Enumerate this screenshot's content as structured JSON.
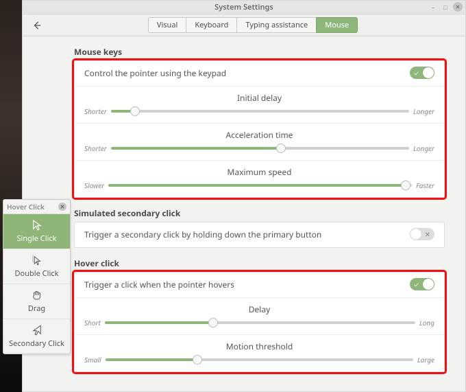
{
  "window": {
    "title": "System Settings"
  },
  "tabs": [
    {
      "label": "Visual",
      "active": false
    },
    {
      "label": "Keyboard",
      "active": false
    },
    {
      "label": "Typing assistance",
      "active": false
    },
    {
      "label": "Mouse",
      "active": true
    }
  ],
  "mouse_keys": {
    "title": "Mouse keys",
    "control_label": "Control the pointer using the keypad",
    "control_on": true,
    "sliders": {
      "initial_delay": {
        "caption": "Initial delay",
        "left": "Shorter",
        "right": "Longer",
        "value_pct": 8
      },
      "acceleration_time": {
        "caption": "Acceleration time",
        "left": "Shorter",
        "right": "Longer",
        "value_pct": 57
      },
      "maximum_speed": {
        "caption": "Maximum speed",
        "left": "Slower",
        "right": "Faster",
        "value_pct": 98
      }
    }
  },
  "sim_secondary": {
    "title": "Simulated secondary click",
    "label": "Trigger a secondary click by holding down the primary button",
    "on": false
  },
  "hover_click": {
    "title": "Hover click",
    "trigger_label": "Trigger a click when the pointer hovers",
    "trigger_on": true,
    "sliders": {
      "delay": {
        "caption": "Delay",
        "left": "Short",
        "right": "Long",
        "value_pct": 35
      },
      "motion_threshold": {
        "caption": "Motion threshold",
        "left": "Small",
        "right": "Large",
        "value_pct": 30
      }
    }
  },
  "palette": {
    "title": "Hover Click",
    "items": [
      {
        "label": "Single Click",
        "icon": "cursor",
        "active": true
      },
      {
        "label": "Double Click",
        "icon": "cursor-double",
        "active": false
      },
      {
        "label": "Drag",
        "icon": "hand",
        "active": false
      },
      {
        "label": "Secondary Click",
        "icon": "cursor-right",
        "active": false
      }
    ]
  },
  "colors": {
    "accent": "#8fb67a",
    "highlight_border": "#e11"
  }
}
